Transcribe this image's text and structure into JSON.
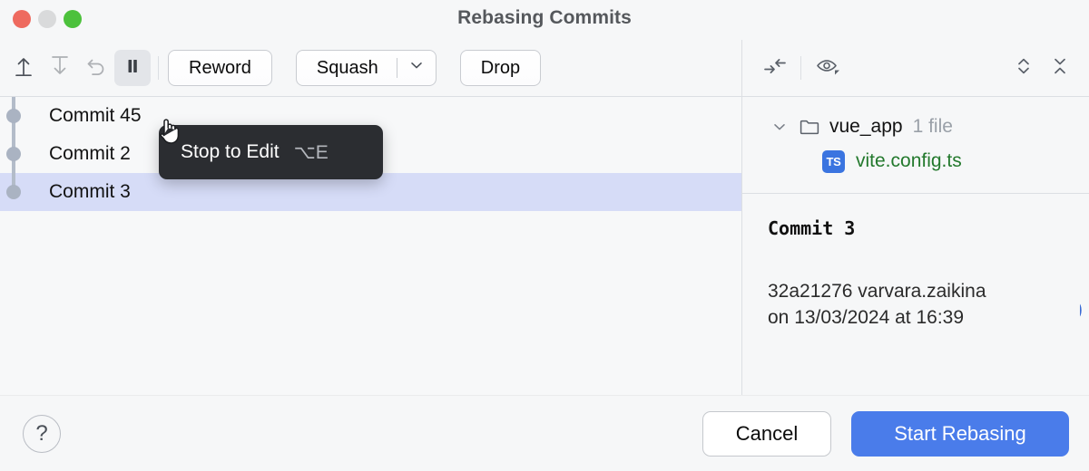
{
  "window": {
    "title": "Rebasing Commits",
    "traffic_lights": [
      "close",
      "minimize",
      "zoom"
    ]
  },
  "toolbar": {
    "icons": [
      {
        "name": "move-up-icon",
        "tooltip": "Move Up",
        "enabled": true
      },
      {
        "name": "move-down-icon",
        "tooltip": "Move Down",
        "enabled": false
      },
      {
        "name": "undo-icon",
        "tooltip": "Undo",
        "enabled": false
      },
      {
        "name": "stop-to-edit-pause-icon",
        "tooltip": "Stop to Edit",
        "enabled": true,
        "pressed": true
      }
    ],
    "reword_label": "Reword",
    "squash_label": "Squash",
    "drop_label": "Drop",
    "squash_dropdown_icon": "chevron-down-icon"
  },
  "tooltip": {
    "label": "Stop to Edit",
    "shortcut": "⌥E"
  },
  "commits": {
    "rows": [
      {
        "subject": "Commit 45",
        "selected": false
      },
      {
        "subject": "Commit 2",
        "selected": false
      },
      {
        "subject": "Commit 3",
        "selected": true
      }
    ]
  },
  "changes_panel": {
    "toolbar_icons": [
      {
        "name": "show-diff-icon",
        "tooltip": "Show Diff"
      },
      {
        "name": "preview-eye-icon",
        "tooltip": "Preview"
      },
      {
        "name": "expand-all-icon",
        "tooltip": "Expand All"
      },
      {
        "name": "collapse-all-icon",
        "tooltip": "Collapse All"
      }
    ],
    "tree": {
      "folder_name": "vue_app",
      "folder_count": "1 file",
      "folder_icon": "folder-icon",
      "chevron_icon": "chevron-down-icon",
      "files": [
        {
          "name": "vite.config.ts",
          "badge": "TS",
          "badge_icon": "typescript-file-icon",
          "color": "#23792d"
        }
      ]
    }
  },
  "details": {
    "subject": "Commit 3",
    "meta_line_1": "32a21276 varvara.zaikina",
    "meta_line_2": "on 13/03/2024 at 16:39",
    "clipped_link": ")"
  },
  "footer": {
    "help_label": "?",
    "help_icon": "question-mark-icon",
    "cancel_label": "Cancel",
    "primary_label": "Start Rebasing"
  },
  "colors": {
    "accent": "#4a7cea",
    "selection": "#d6dcf7",
    "background": "#f6f7f8",
    "added_file": "#23792d",
    "tooltip_bg": "#2b2d31",
    "graph_node": "#aab3c2"
  }
}
